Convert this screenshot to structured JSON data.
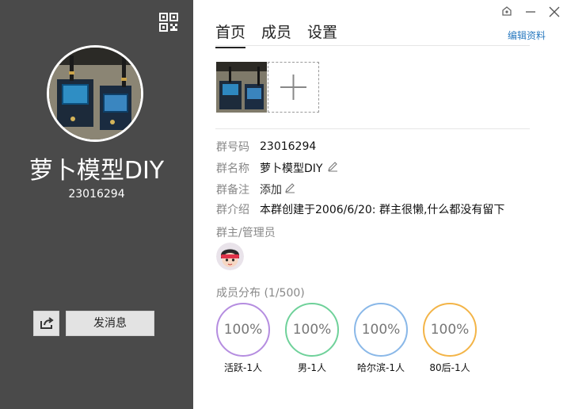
{
  "profile": {
    "group_name": "萝卜模型DIY",
    "group_id": "23016294",
    "send_message_label": "发消息"
  },
  "icons": {
    "qr": "qr-code-icon",
    "share": "share-icon",
    "skin": "skin-icon",
    "minimize": "minimize-icon",
    "close": "close-icon",
    "pencil": "pencil-icon",
    "plus": "plus-icon"
  },
  "tabs": [
    {
      "label": "首页",
      "active": true
    },
    {
      "label": "成员",
      "active": false
    },
    {
      "label": "设置",
      "active": false
    }
  ],
  "edit_profile_label": "编辑资料",
  "info": {
    "number_label": "群号码",
    "number_value": "23016294",
    "name_label": "群名称",
    "name_value": "萝卜模型DIY",
    "remark_label": "群备注",
    "remark_value": "添加",
    "intro_label": "群介绍",
    "intro_value": "本群创建于2006/6/20:  群主很懒,什么都没有留下"
  },
  "admins_label": "群主/管理员",
  "distribution": {
    "label": "成员分布 (1/500)",
    "items": [
      {
        "percent_label": "100%",
        "caption": "活跃-1人",
        "color": "#b58de0"
      },
      {
        "percent_label": "100%",
        "caption": "男-1人",
        "color": "#6fd19a"
      },
      {
        "percent_label": "100%",
        "caption": "哈尔滨-1人",
        "color": "#8ab8e8"
      },
      {
        "percent_label": "100%",
        "caption": "80后-1人",
        "color": "#f3b447"
      }
    ]
  },
  "colors": {
    "left_panel": "#4a4a4a",
    "link": "#2a7ac0"
  }
}
